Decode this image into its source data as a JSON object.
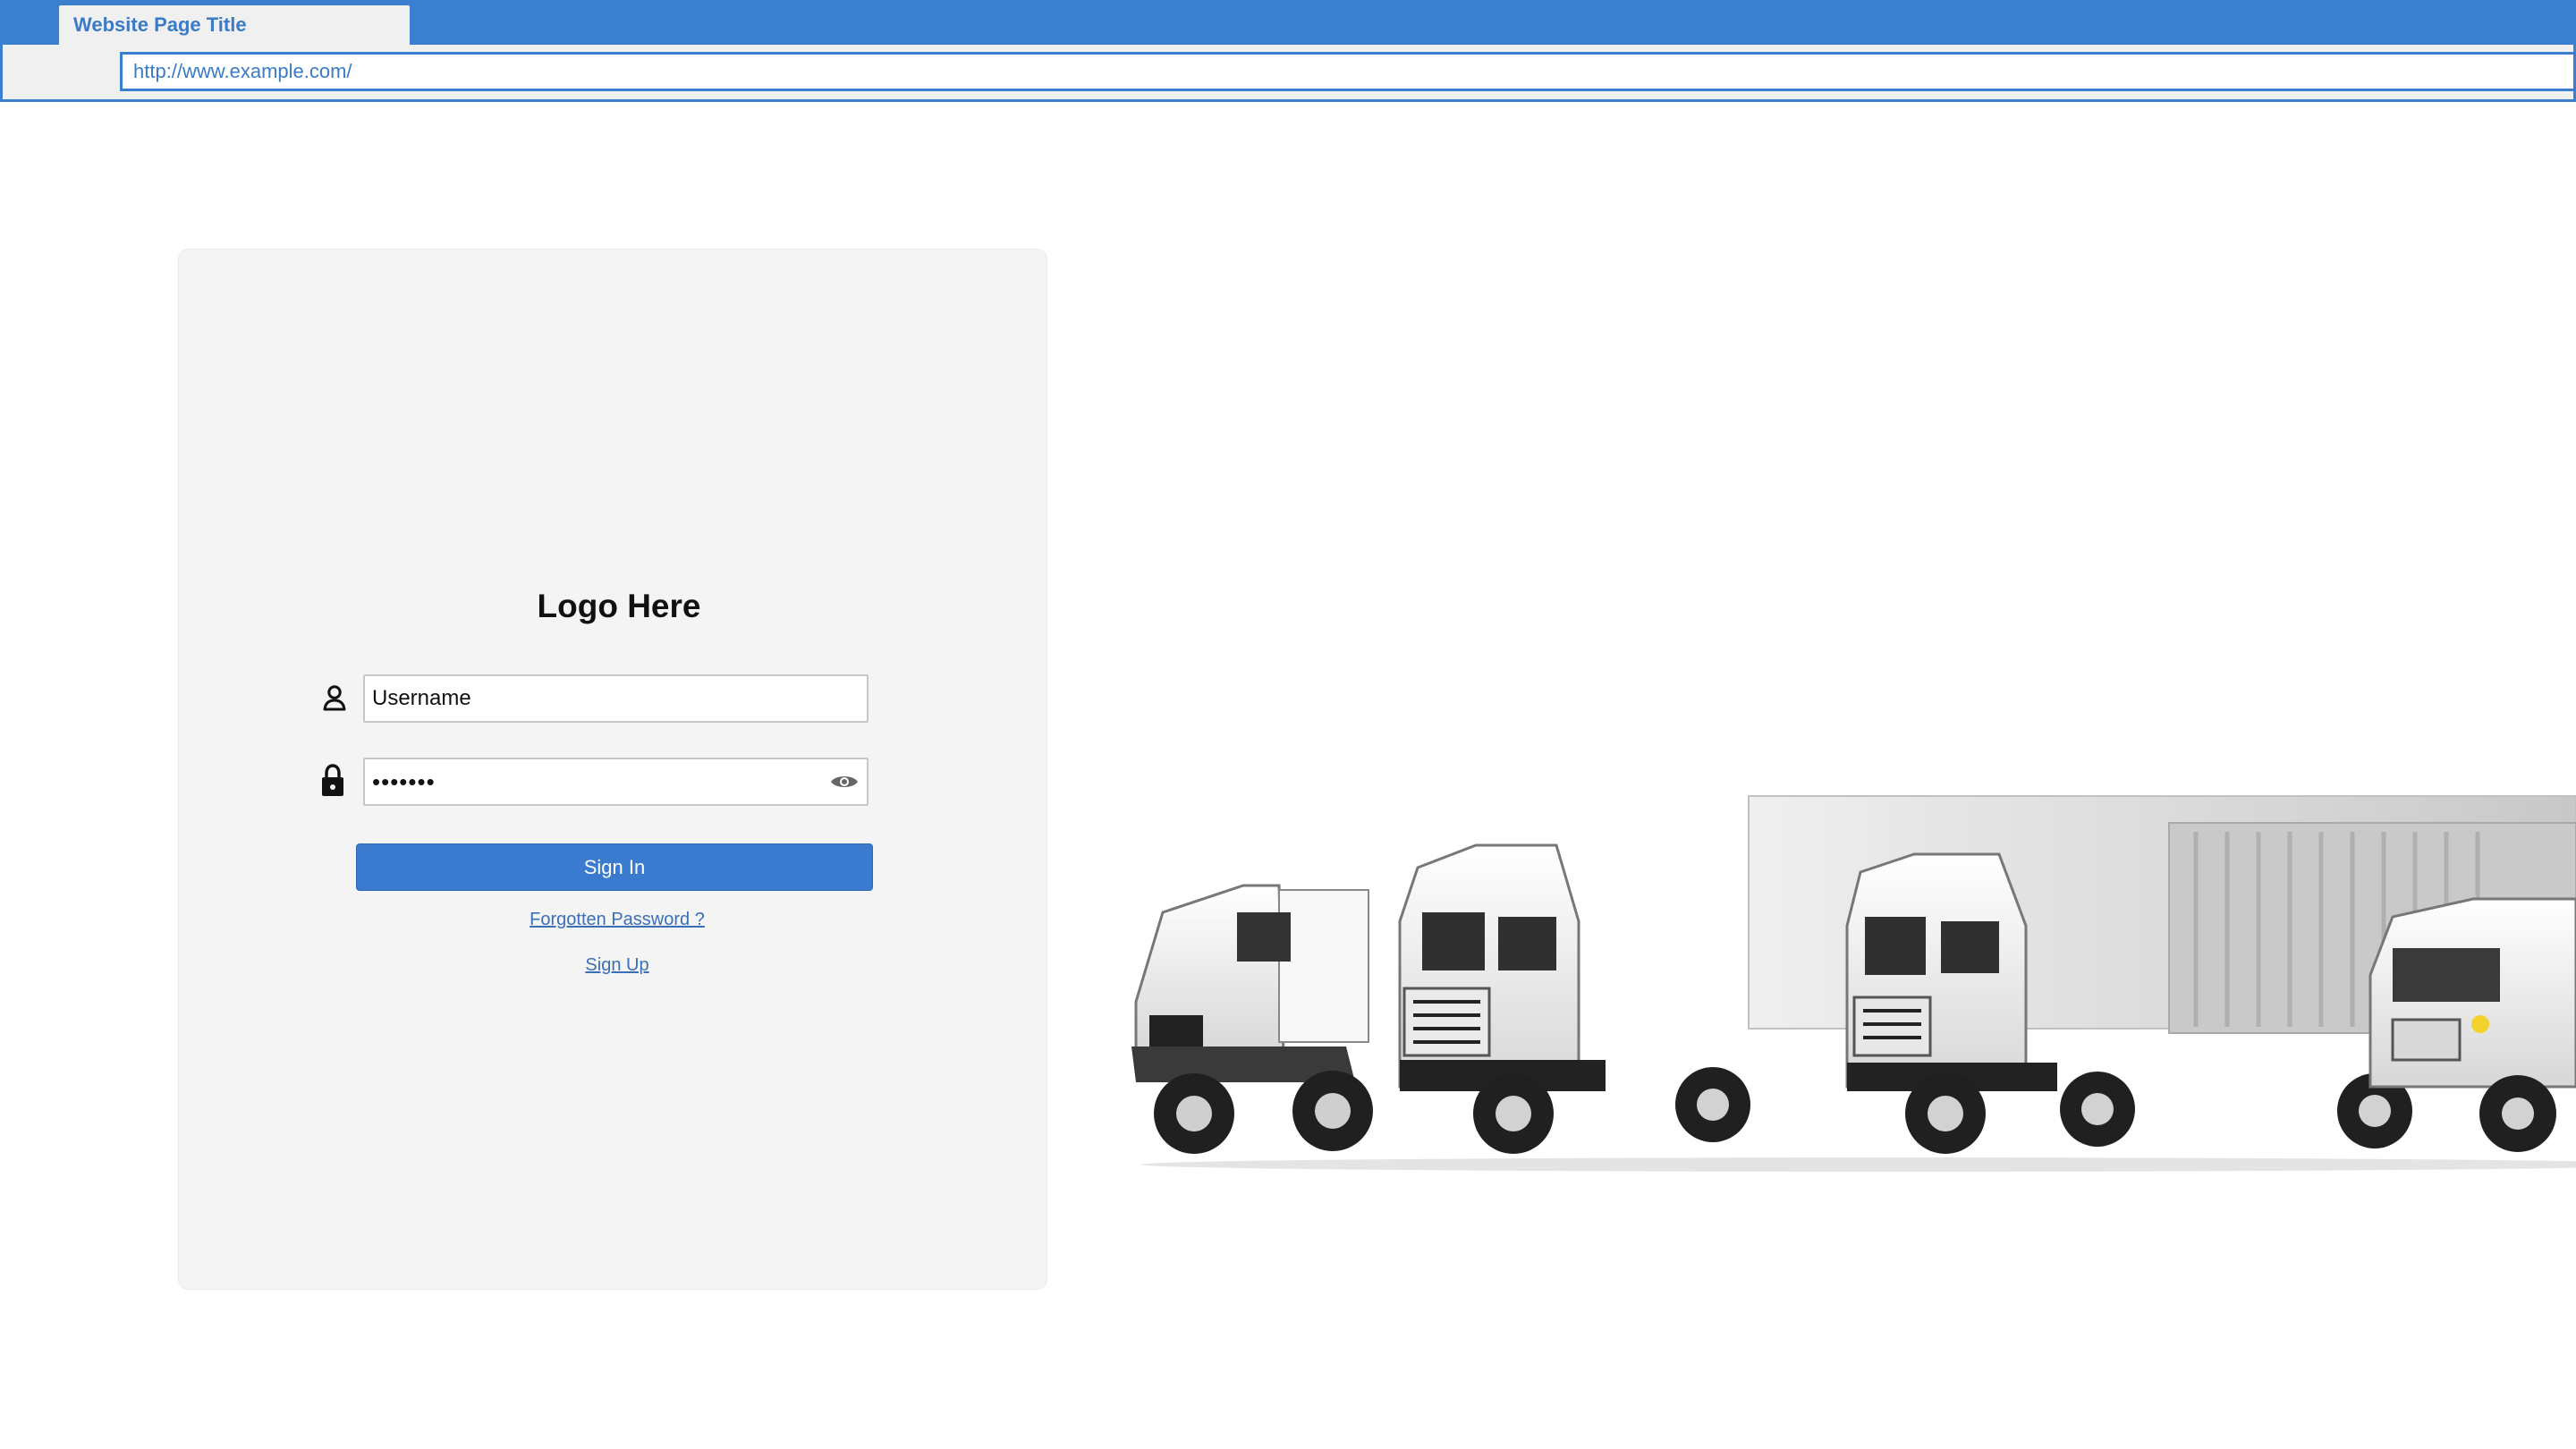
{
  "browser": {
    "tab_title": "Website Page Title",
    "url": "http://www.example.com/"
  },
  "login": {
    "logo_text": "Logo Here",
    "username_value": "Username",
    "password_value": "•••••••",
    "sign_in_label": "Sign In",
    "forgot_password_label": "Forgotten Password ?",
    "sign_up_label": "Sign Up"
  },
  "icons": {
    "username": "user-icon",
    "password": "lock-icon",
    "show_password": "eye-icon"
  },
  "colors": {
    "browser_blue": "#3a80cf",
    "card_background": "#f4f4f4",
    "button_blue": "#3a7bd0",
    "link_blue": "#3a6fb8"
  }
}
